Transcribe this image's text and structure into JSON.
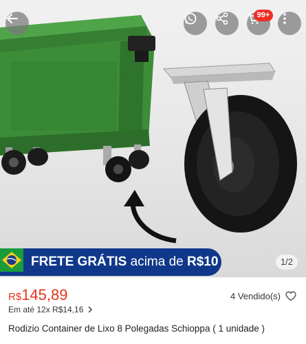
{
  "top_bar": {
    "cart_badge": "99+"
  },
  "promo": {
    "text_main": "FRETE GRÁTIS",
    "text_mid": " acima de ",
    "text_amount": "R$10"
  },
  "gallery": {
    "counter": "1/2"
  },
  "product": {
    "currency": "R$",
    "price": "145,89",
    "sold": "4 Vendido(s)",
    "installments": "Em até 12x R$14,16",
    "title": "Rodizio Container de Lixo 8 Polegadas Schioppa ( 1 unidade )"
  },
  "colors": {
    "price": "#e5331b",
    "promo_bg": "#10388a",
    "badge": "#ee2e24",
    "container_green": "#3d8f3a"
  },
  "icons": [
    "back-arrow-icon",
    "whatsapp-icon",
    "share-icon",
    "cart-icon",
    "more-icon",
    "brazil-flag-icon",
    "heart-icon",
    "chevron-right-icon"
  ]
}
